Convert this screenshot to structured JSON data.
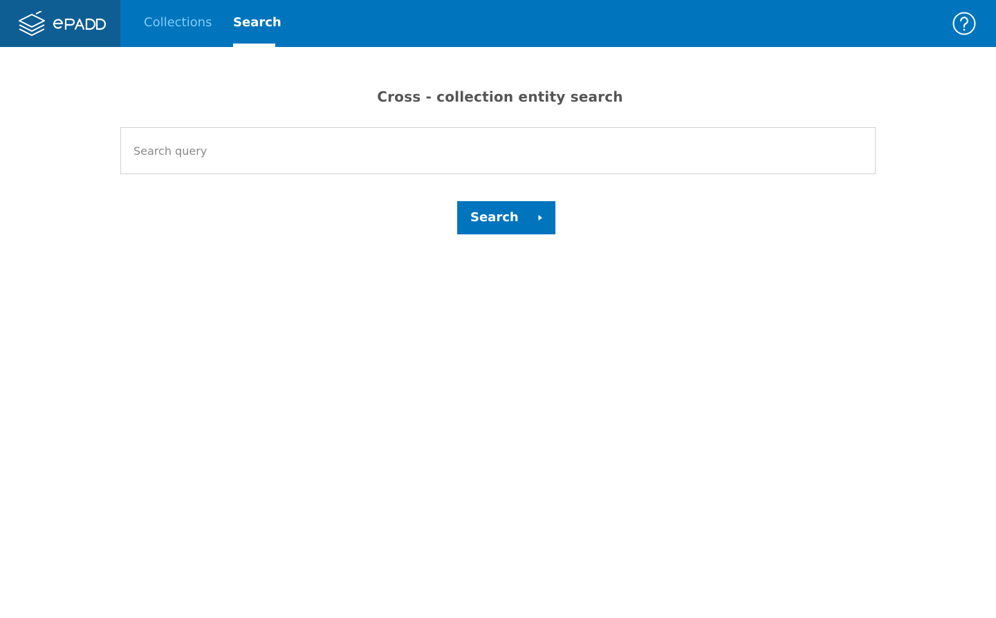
{
  "header": {
    "brand": "EPADD",
    "nav": [
      {
        "label": "Collections",
        "active": false
      },
      {
        "label": "Search",
        "active": true
      }
    ],
    "help_icon": "question-circle-icon"
  },
  "main": {
    "heading": "Cross - collection entity search",
    "search": {
      "placeholder": "Search query",
      "value": ""
    },
    "search_button": {
      "label": "Search",
      "icon": "caret-right-icon"
    }
  },
  "colors": {
    "header_bg": "#0075bd",
    "logo_bg": "#0e5e94",
    "inactive_tab": "#84caf6",
    "button_bg": "#0075bd"
  }
}
